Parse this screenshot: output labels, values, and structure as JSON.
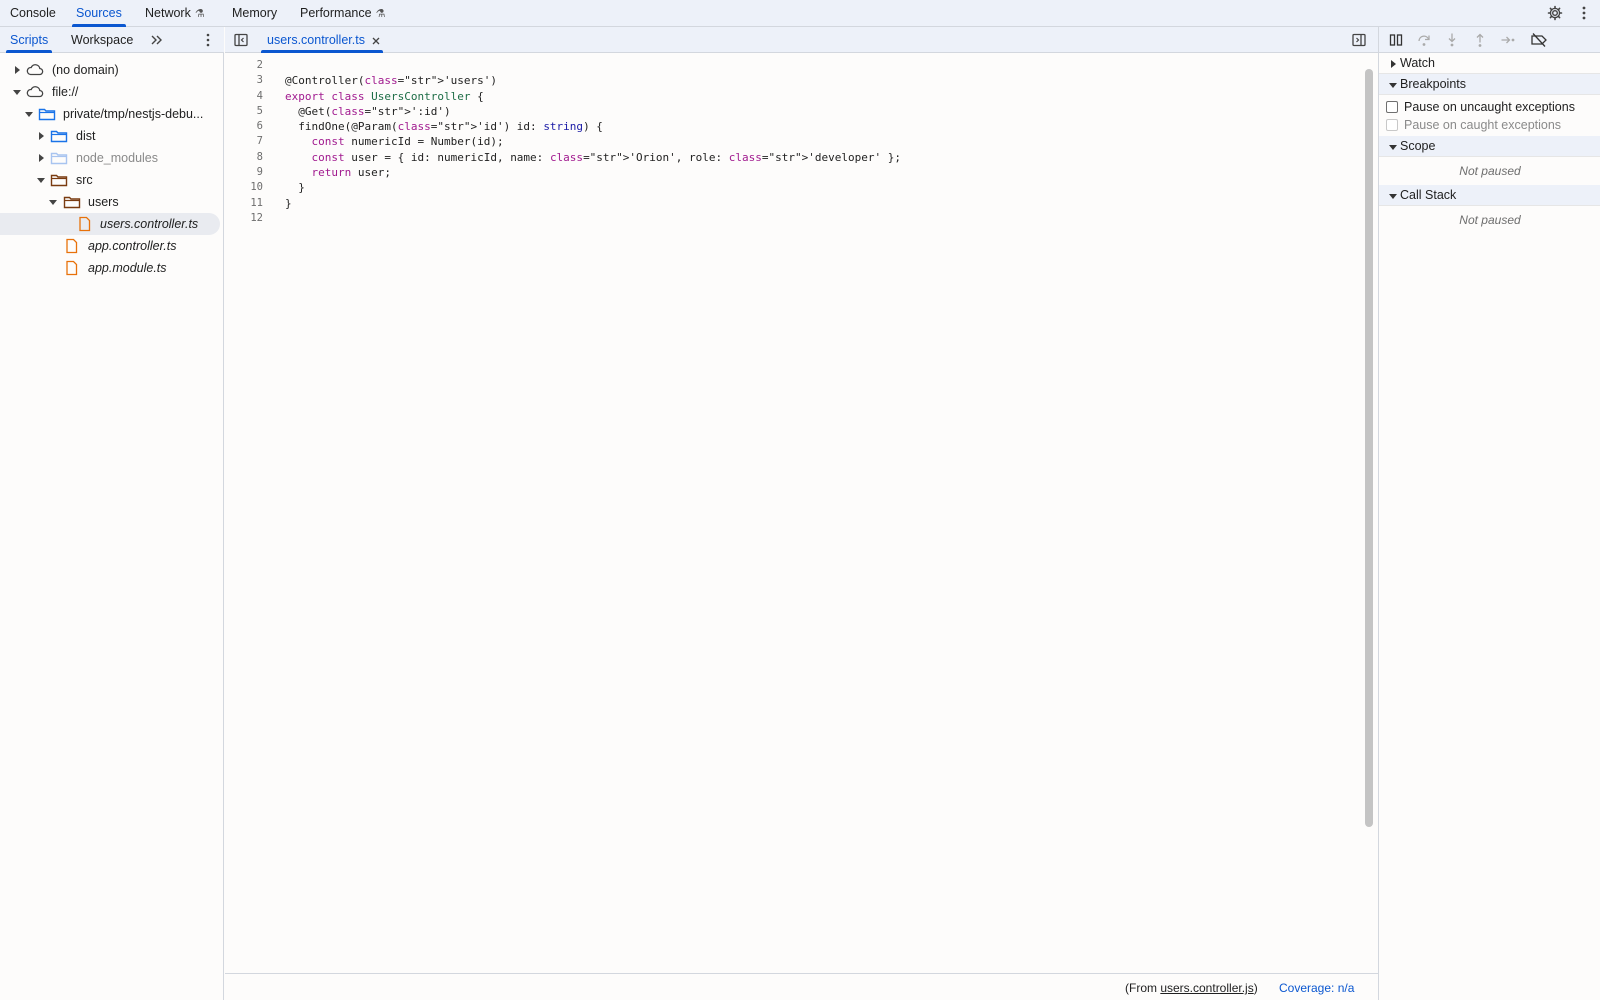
{
  "top_tabs": [
    {
      "label": "Console"
    },
    {
      "label": "Sources",
      "active": true
    },
    {
      "label": "Network",
      "experimental": true
    },
    {
      "label": "Memory"
    },
    {
      "label": "Performance",
      "experimental": true
    }
  ],
  "top_right_icons": [
    "settings-gear-icon",
    "more-vertical-icon"
  ],
  "navigator": {
    "tabs": [
      {
        "label": "Scripts",
        "active": true
      },
      {
        "label": "Workspace"
      }
    ],
    "more_tabs_icon": "chevron-double-right-icon",
    "menu_icon": "more-vertical-icon",
    "tree": [
      {
        "label": "(no domain)",
        "icon": "cloud-icon",
        "expanded": false
      },
      {
        "label": "file://",
        "icon": "cloud-icon",
        "expanded": true
      },
      {
        "label": "private/tmp/nestjs-debu...",
        "icon": "folder-icon",
        "expanded": true
      },
      {
        "label": "dist",
        "icon": "folder-icon",
        "expanded": false
      },
      {
        "label": "node_modules",
        "icon": "folder-icon",
        "expanded": false,
        "dimmed": true
      },
      {
        "label": "src",
        "icon": "folder-icon",
        "expanded": true
      },
      {
        "label": "users",
        "icon": "folder-icon",
        "expanded": true
      },
      {
        "label": "users.controller.ts",
        "icon": "file-icon",
        "selected": true
      },
      {
        "label": "app.controller.ts",
        "icon": "file-icon"
      },
      {
        "label": "app.module.ts",
        "icon": "file-icon"
      }
    ]
  },
  "editor": {
    "toggle_navigator_icon": "panel-left-icon",
    "toggle_debugger_icon": "panel-right-icon",
    "open_file": {
      "label": "users.controller.ts",
      "close_icon": "close-icon"
    },
    "lines": [
      {
        "n": "2",
        "code": ""
      },
      {
        "n": "3",
        "code": "@Controller('users')"
      },
      {
        "n": "4",
        "code": "export class UsersController {"
      },
      {
        "n": "5",
        "code": "  @Get(':id')"
      },
      {
        "n": "6",
        "code": "  findOne(@Param('id') id: string) {"
      },
      {
        "n": "7",
        "code": "    const numericId = Number(id);"
      },
      {
        "n": "8",
        "code": "    const user = { id: numericId, name: 'Orion', role: 'developer' };"
      },
      {
        "n": "9",
        "code": "    return user;"
      },
      {
        "n": "10",
        "code": "  }"
      },
      {
        "n": "11",
        "code": "}"
      },
      {
        "n": "12",
        "code": ""
      }
    ],
    "status": {
      "from_prefix": "(From ",
      "from_link": "users.controller.js",
      "from_suffix": ")",
      "coverage": "Coverage: n/a"
    }
  },
  "debugger": {
    "toolbar_icons": [
      "pause-resume-icon",
      "step-over-icon",
      "step-into-icon",
      "step-out-icon",
      "step-icon",
      "deactivate-breakpoints-icon"
    ],
    "sections": {
      "watch": "Watch",
      "breakpoints": "Breakpoints",
      "pause_uncaught": "Pause on uncaught exceptions",
      "pause_caught": "Pause on caught exceptions",
      "scope": "Scope",
      "scope_status": "Not paused",
      "call_stack": "Call Stack",
      "call_stack_status": "Not paused"
    }
  },
  "colors": {
    "accent": "#0b57d0",
    "folder": "#1a73e8",
    "file": "#e8710a",
    "keyword": "#a11a8f",
    "string": "#b3261e",
    "class_name": "#1d6d46"
  }
}
